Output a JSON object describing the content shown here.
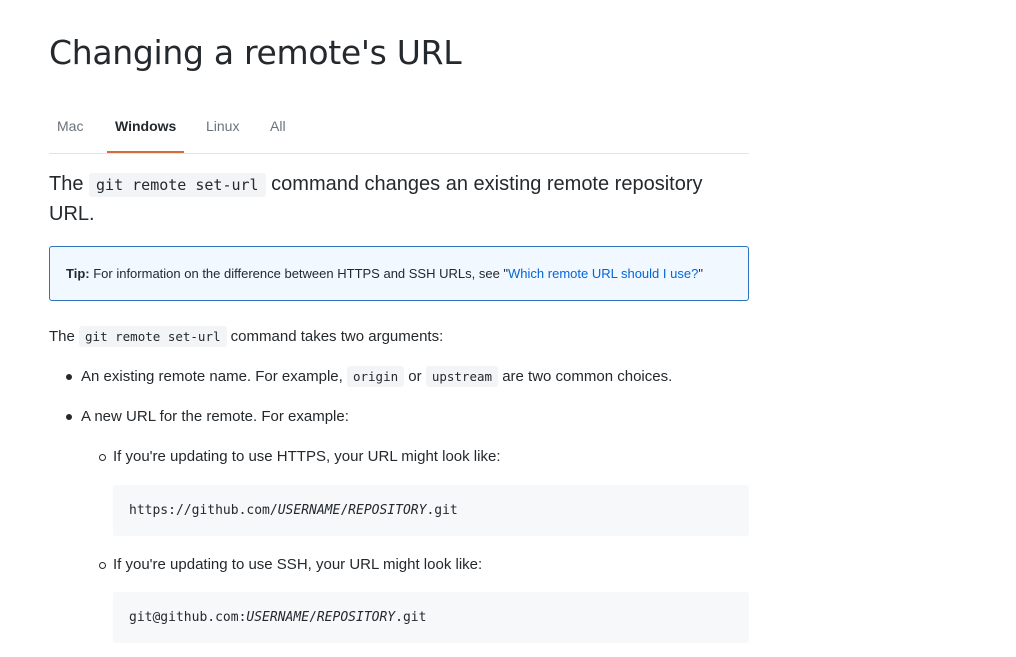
{
  "title": "Changing a remote's URL",
  "tabs": [
    {
      "label": "Mac",
      "active": false
    },
    {
      "label": "Windows",
      "active": true
    },
    {
      "label": "Linux",
      "active": false
    },
    {
      "label": "All",
      "active": false
    }
  ],
  "lead": {
    "before": "The",
    "code": "git remote set-url",
    "after": "command changes an existing remote repository URL."
  },
  "tip": {
    "label": "Tip:",
    "text": "For information on the difference between HTTPS and SSH URLs, see \"",
    "link": "Which remote URL should I use?",
    "after": "\""
  },
  "intro": {
    "before": "The",
    "code": "git remote set-url",
    "after": "command takes two arguments:"
  },
  "bullets": {
    "first": {
      "text1": "An existing remote name. For example,",
      "code1": "origin",
      "text2": "or",
      "code2": "upstream",
      "text3": "are two common choices."
    },
    "second": {
      "text": "A new URL for the remote. For example:"
    }
  },
  "subitems": {
    "https": {
      "text": "If you're updating to use HTTPS, your URL might look like:",
      "code_prefix": "https://github.com/",
      "code_user": "USERNAME",
      "code_sep": "/",
      "code_repo": "REPOSITORY",
      "code_suffix": ".git"
    },
    "ssh": {
      "text": "If you're updating to use SSH, your URL might look like:",
      "code_prefix": "git@github.com:",
      "code_user": "USERNAME",
      "code_sep": "/",
      "code_repo": "REPOSITORY",
      "code_suffix": ".git"
    }
  },
  "colors": {
    "accent_tab": "#d26b3e",
    "tip_border": "#2f73c0",
    "tip_bg": "#f1f8ff",
    "link": "#0366d6",
    "code_bg": "#f6f8fa"
  }
}
